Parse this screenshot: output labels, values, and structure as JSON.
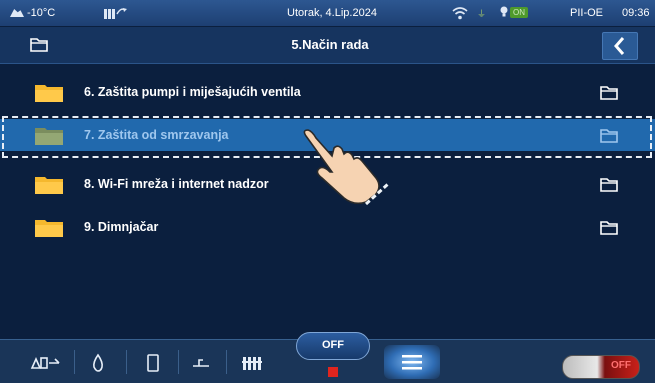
{
  "status_bar": {
    "temperature": "-10°C",
    "date": "Utorak, 4.Lip.2024",
    "bulb_status": "ON",
    "user": "PII-OE",
    "time": "09:36"
  },
  "title_bar": {
    "title": "5.Način rada"
  },
  "menu_items": [
    {
      "label": "6.  Zaštita pumpi i miješajućih ventila"
    },
    {
      "label": "7.  Zaštita od smrzavanja"
    },
    {
      "label": "8.  Wi-Fi mreža i internet nadzor"
    },
    {
      "label": "9.  Dimnjačar"
    }
  ],
  "selected_index": 1,
  "bottom_bar": {
    "off_label": "OFF",
    "toggle_label": "OFF"
  },
  "colors": {
    "background": "#0b1f3e",
    "selected_row": "#2169ad",
    "folder": "#f5b82e",
    "selected_folder": "#8a9a6a"
  }
}
